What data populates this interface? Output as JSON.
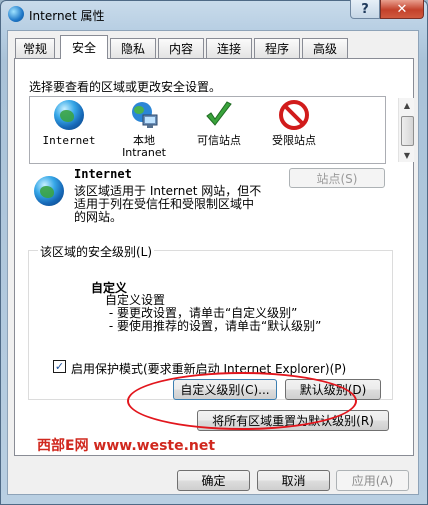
{
  "window": {
    "title": "Internet 属性",
    "help": "?",
    "close": "✕"
  },
  "tabs": [
    "常规",
    "安全",
    "隐私",
    "内容",
    "连接",
    "程序",
    "高级"
  ],
  "active_tab": "安全",
  "zone_prompt": "选择要查看的区域或更改安全设置。",
  "zones": [
    {
      "label": "Internet",
      "icon": "globe-icon"
    },
    {
      "label": "本地\nIntranet",
      "icon": "intranet-icon"
    },
    {
      "label": "可信站点",
      "icon": "checkmark-icon"
    },
    {
      "label": "受限站点",
      "icon": "no-entry-icon"
    }
  ],
  "selected_zone": {
    "name": "Internet",
    "description": "该区域适用于 Internet 网站，但不适用于列在受信任和受限制区域中的网站。",
    "sites_button": "站点(S)"
  },
  "security_level": {
    "group_label": "该区域的安全级别(L)",
    "level_name": "自定义",
    "description": "自定义设置\n - 要更改设置，请单击“自定义级别”\n - 要使用推荐的设置，请单击“默认级别”",
    "protected_mode_label": "启用保护模式(要求重新启动 Internet Explorer)(P)",
    "protected_mode_checked": true,
    "custom_button": "自定义级别(C)...",
    "default_button": "默认级别(D)",
    "reset_button": "将所有区域重置为默认级别(R)"
  },
  "watermark": "西部E网  www.weste.net",
  "dialog_buttons": {
    "ok": "确定",
    "cancel": "取消",
    "apply": "应用(A)"
  },
  "colors": {
    "annotation_ellipse": "#e2161d",
    "watermark": "#d0281e"
  }
}
